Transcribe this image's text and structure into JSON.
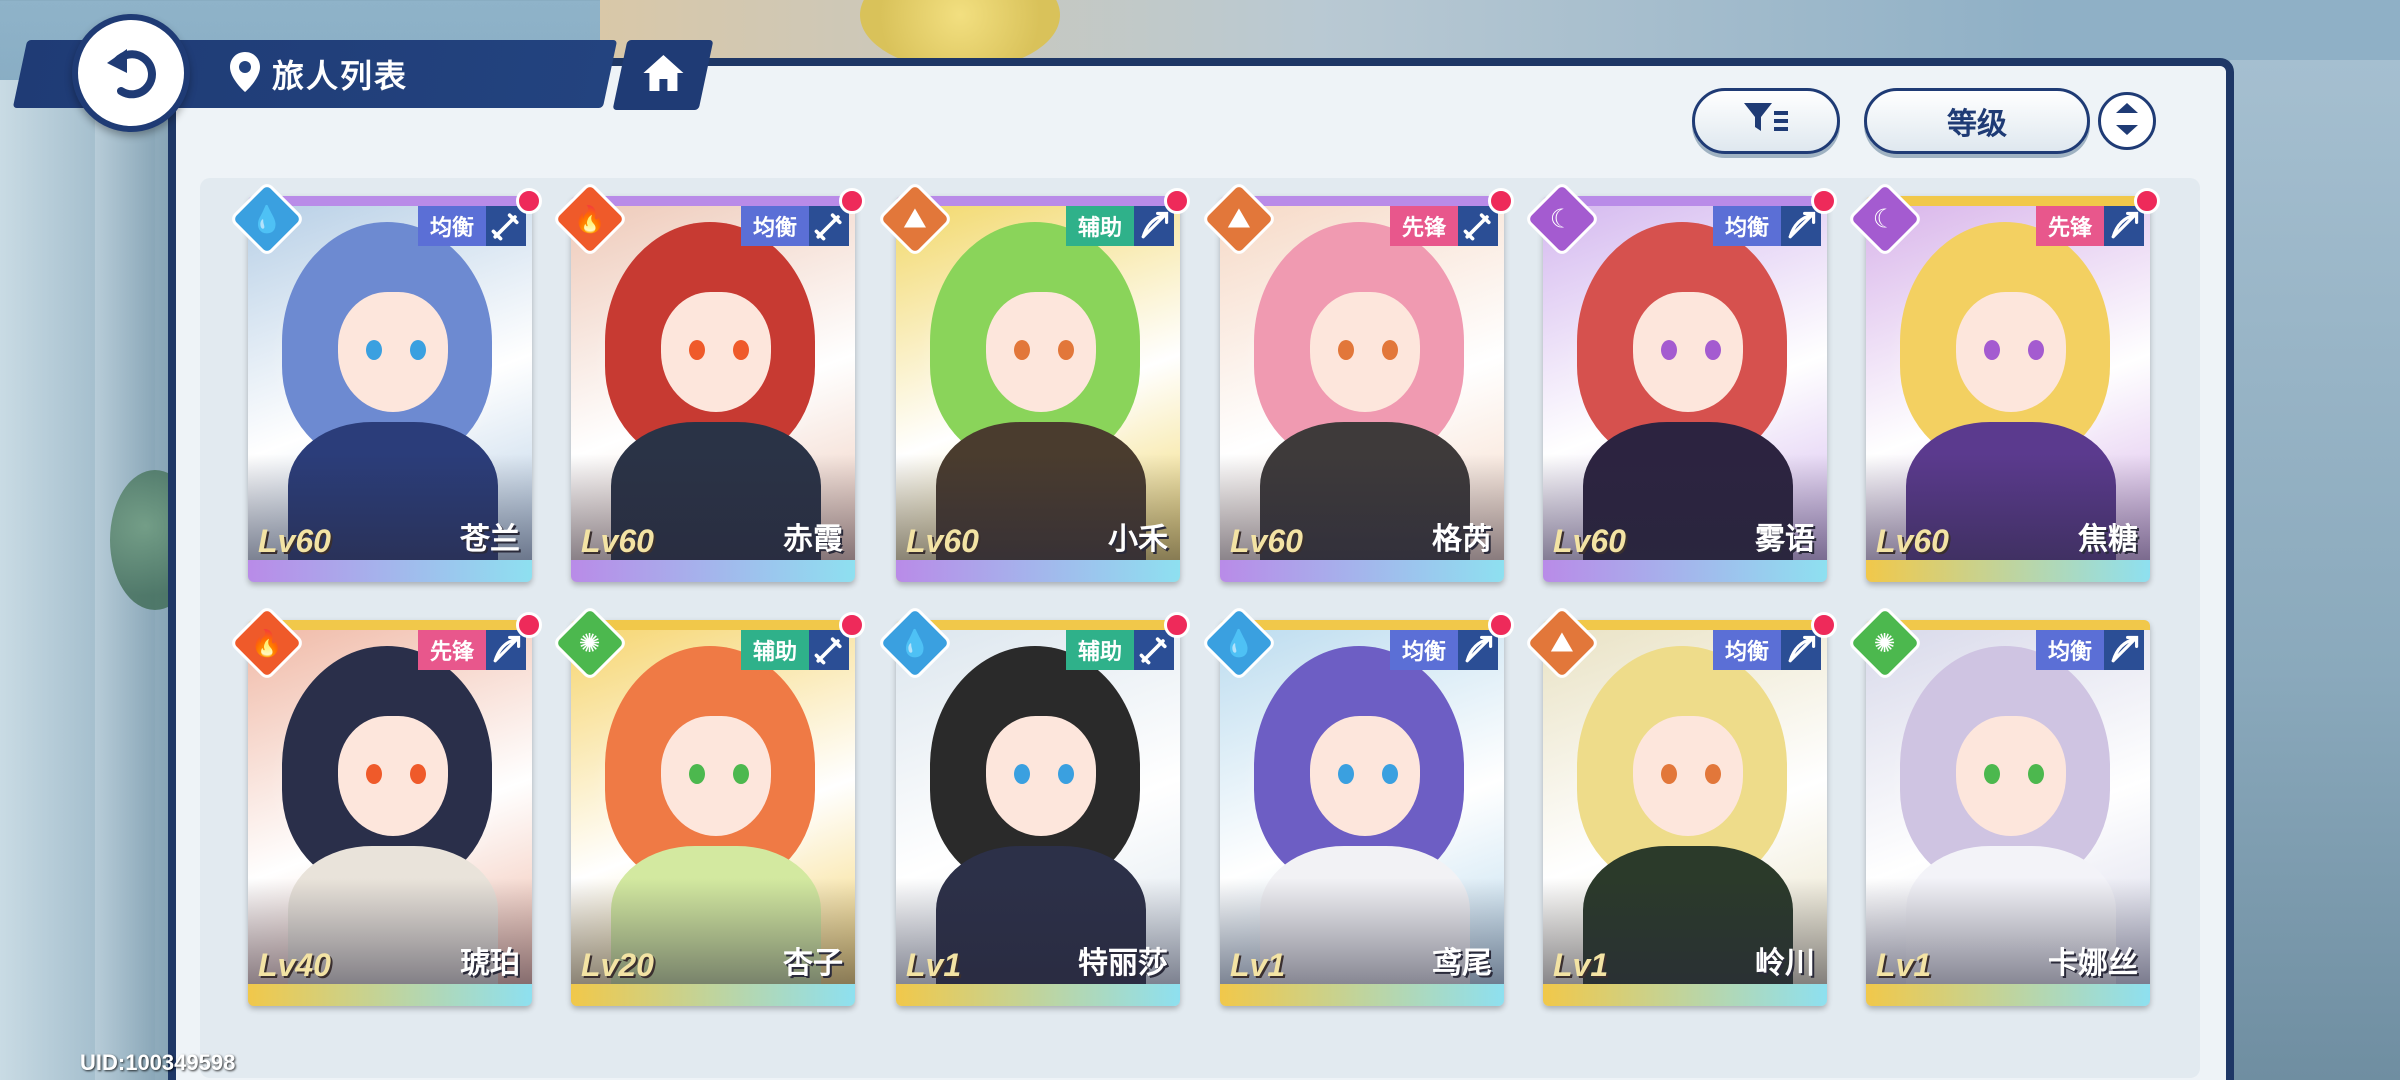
{
  "header": {
    "title": "旅人列表"
  },
  "controls": {
    "sort_label": "等级"
  },
  "user": {
    "uid": "UID:100349598"
  },
  "cards": [
    {
      "name": "苍兰",
      "level": "Lv60",
      "role": "均衡",
      "element": "water-icon",
      "element_color": "#3aa0e0",
      "role_color": "#5b6fd6",
      "hair_color": "#6d8ad1",
      "body_color": "#2b3d7a",
      "bg_color": "#b7cfe6",
      "strip_color": "#b98be8",
      "has_dot": true
    },
    {
      "name": "赤霞",
      "level": "Lv60",
      "role": "均衡",
      "element": "fire-icon",
      "element_color": "#ef5a2a",
      "role_color": "#5b6fd6",
      "hair_color": "#c73a32",
      "body_color": "#2a3346",
      "bg_color": "#eec9b8",
      "strip_color": "#b98be8",
      "has_dot": true
    },
    {
      "name": "小禾",
      "level": "Lv60",
      "role": "辅助",
      "element": "earth-icon",
      "element_color": "#e2773a",
      "role_color": "#2fb18a",
      "hair_color": "#8ad45a",
      "body_color": "#4a3c2e",
      "bg_color": "#f2d86a",
      "strip_color": "#b98be8",
      "has_dot": true
    },
    {
      "name": "格芮",
      "level": "Lv60",
      "role": "先锋",
      "element": "earth-icon",
      "element_color": "#e2773a",
      "role_color": "#e8578c",
      "hair_color": "#f09ab1",
      "body_color": "#3e3a3a",
      "bg_color": "#f6d9c6",
      "strip_color": "#b98be8",
      "has_dot": true
    },
    {
      "name": "雾语",
      "level": "Lv60",
      "role": "均衡",
      "element": "moon-icon",
      "element_color": "#a45bd0",
      "role_color": "#5b6fd6",
      "hair_color": "#d6514e",
      "body_color": "#2c2340",
      "bg_color": "#d4b8ef",
      "strip_color": "#b98be8",
      "has_dot": true
    },
    {
      "name": "焦糖",
      "level": "Lv60",
      "role": "先锋",
      "element": "moon-icon",
      "element_color": "#a45bd0",
      "role_color": "#e8578c",
      "hair_color": "#f3d061",
      "body_color": "#5b3a8e",
      "bg_color": "#d8b4ea",
      "strip_color": "#f1c84a",
      "has_dot": true
    },
    {
      "name": "琥珀",
      "level": "Lv40",
      "role": "先锋",
      "element": "fire-icon",
      "element_color": "#ef5a2a",
      "role_color": "#e8578c",
      "hair_color": "#2a2f4a",
      "body_color": "#e9e3da",
      "bg_color": "#f0b9a6",
      "strip_color": "#f1c84a",
      "has_dot": true
    },
    {
      "name": "杏子",
      "level": "Lv20",
      "role": "辅助",
      "element": "wind-icon",
      "element_color": "#4cb84e",
      "role_color": "#2fb18a",
      "hair_color": "#ef7a45",
      "body_color": "#d3e9a0",
      "bg_color": "#f6d56f",
      "strip_color": "#f1c84a",
      "has_dot": true
    },
    {
      "name": "特丽莎",
      "level": "Lv1",
      "role": "辅助",
      "element": "water-icon",
      "element_color": "#3aa0e0",
      "role_color": "#2fb18a",
      "hair_color": "#2a2a2a",
      "body_color": "#2c3048",
      "bg_color": "#dce6ee",
      "strip_color": "#f1c84a",
      "has_dot": true
    },
    {
      "name": "鸢尾",
      "level": "Lv1",
      "role": "均衡",
      "element": "water-icon",
      "element_color": "#3aa0e0",
      "role_color": "#5b6fd6",
      "hair_color": "#6d5ec4",
      "body_color": "#f2f2f5",
      "bg_color": "#bcdcef",
      "strip_color": "#f1c84a",
      "has_dot": true
    },
    {
      "name": "岭川",
      "level": "Lv1",
      "role": "均衡",
      "element": "earth-icon",
      "element_color": "#e2773a",
      "role_color": "#5b6fd6",
      "hair_color": "#eedc8a",
      "body_color": "#2b3a2a",
      "bg_color": "#e9e2c4",
      "strip_color": "#f1c84a",
      "has_dot": true
    },
    {
      "name": "卡娜丝",
      "level": "Lv1",
      "role": "均衡",
      "element": "wind-icon",
      "element_color": "#4cb84e",
      "role_color": "#5b6fd6",
      "hair_color": "#cfc4e2",
      "body_color": "#f3f3f8",
      "bg_color": "#d8d9ea",
      "strip_color": "#f1c84a",
      "has_dot": false
    }
  ]
}
